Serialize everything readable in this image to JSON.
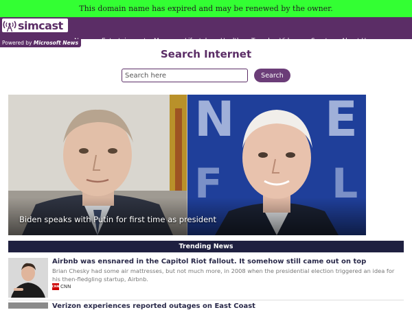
{
  "banner": {
    "text": "This domain name has expired and may be renewed by the owner."
  },
  "brand": {
    "name": "simcast",
    "powered_prefix": "Powered by",
    "powered_brand": "Microsoft News",
    "color": "#5b2d66"
  },
  "nav": {
    "items": [
      "News",
      "Entertainment",
      "Money",
      "Lifestyle",
      "Health",
      "Travel",
      "Videos",
      "Sports",
      "About Us"
    ],
    "sub_item": "Pecan"
  },
  "search": {
    "title": "Search Internet",
    "placeholder": "Search here",
    "button_label": "Search"
  },
  "hero": {
    "caption": "Biden speaks with Putin for first time as president"
  },
  "trending": {
    "header": "Trending News",
    "header_color": "#1f2040",
    "articles": [
      {
        "title": "Airbnb was ensnared in the Capitol Riot fallout. It somehow still came out on top",
        "summary": "Brian Chesky had some air mattresses, but not much more, in 2008 when the presidential election triggered an idea for his then-fledgling startup, Airbnb.",
        "source_logo": "CNN",
        "source": "CNN"
      },
      {
        "title": "Verizon experiences reported outages on East Coast"
      }
    ]
  }
}
